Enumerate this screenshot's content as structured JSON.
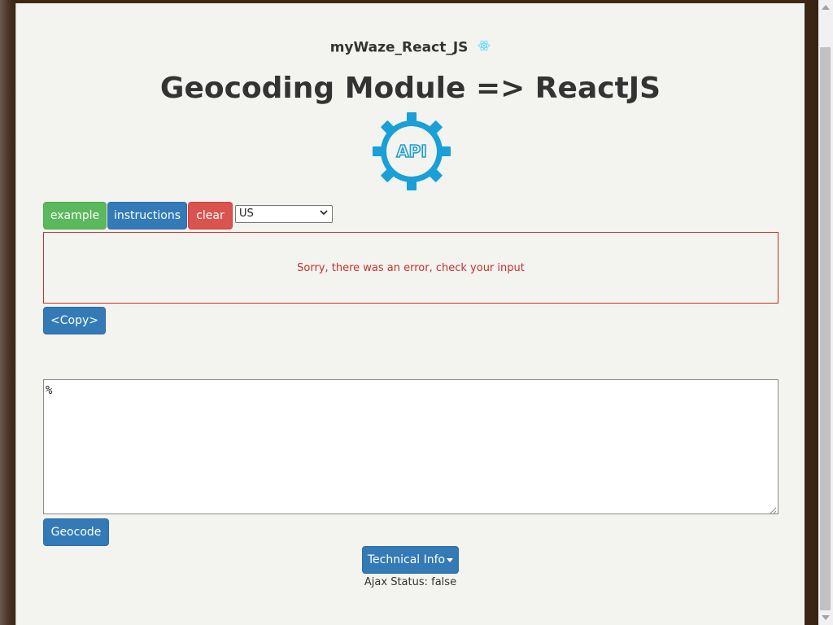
{
  "header": {
    "app_title": "myWaze_React_JS",
    "react_icon": "react-atom-icon",
    "main_title": "Geocoding Module => ReactJS",
    "logo_text": "API"
  },
  "toolbar": {
    "example_label": "example",
    "instructions_label": "instructions",
    "clear_label": "clear",
    "country_selected": "US"
  },
  "error": {
    "message": "Sorry, there was an error, check your input"
  },
  "copy_label": "<Copy>",
  "input": {
    "value": "%"
  },
  "geocode_label": "Geocode",
  "tech_info_label": "Technical Info",
  "ajax_status": "Ajax Status: false",
  "colors": {
    "success": "#5cb85c",
    "primary": "#337ab7",
    "danger": "#d9534f",
    "error_text": "#c9302c",
    "logo_blue": "#1a9fd6"
  }
}
